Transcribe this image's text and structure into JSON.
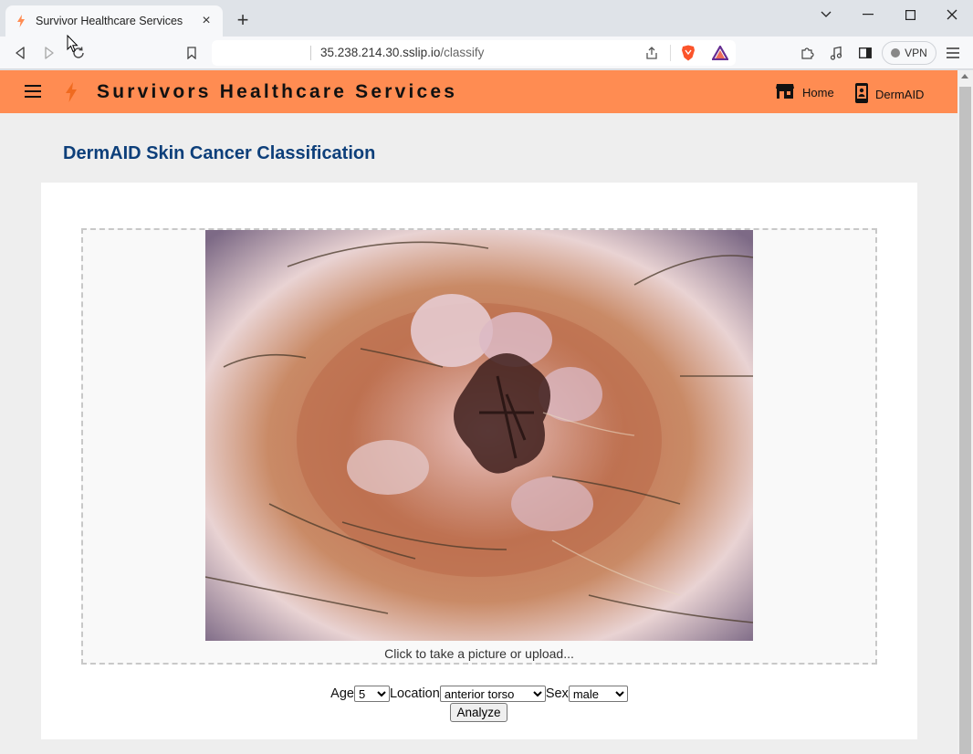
{
  "browser": {
    "tab_title": "Survivor Healthcare Services",
    "url_host": "35.238.214.30.sslip.io",
    "url_path": "/classify",
    "vpn_label": "VPN"
  },
  "appbar": {
    "brand": "Survivors Healthcare Services",
    "nav": [
      {
        "label": "Home",
        "icon": "store-icon"
      },
      {
        "label": "DermAID",
        "icon": "phone-icon"
      }
    ],
    "accent": "#ff8c52"
  },
  "main": {
    "heading": "DermAID Skin Cancer Classification",
    "upload_hint": "Click to take a picture or upload...",
    "form": {
      "age_label": "Age",
      "age_value": "5",
      "location_label": "Location",
      "location_value": "anterior torso",
      "sex_label": "Sex",
      "sex_value": "male",
      "analyze_label": "Analyze"
    }
  },
  "colors": {
    "heading": "#0d3f7a",
    "page_bg": "#eeeeee"
  }
}
